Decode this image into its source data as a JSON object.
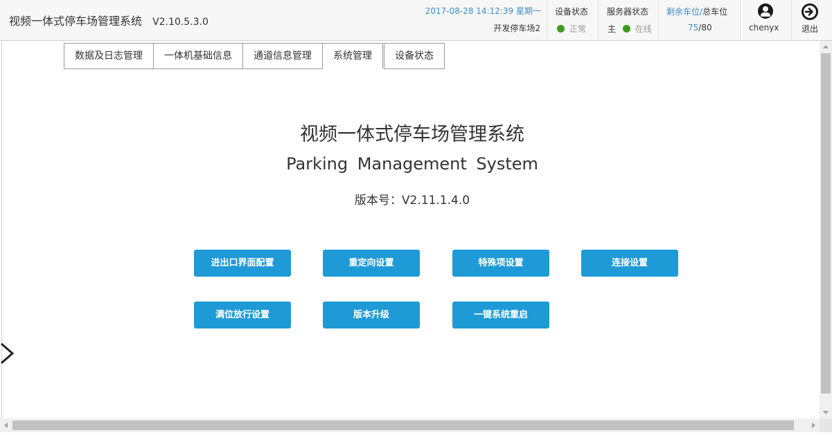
{
  "header": {
    "app_title": "视频一体式停车场管理系统",
    "app_version": "V2.10.5.3.0",
    "datetime": "2017-08-28 14:12:39 星期一",
    "parking_lot": "开发停车场2",
    "device_status_label": "设备状态",
    "device_status_value": "正常",
    "server_status_label": "服务器状态",
    "server_role": "主",
    "server_status_value": "在线",
    "spaces_label_remaining": "剩余车位",
    "spaces_label_sep": "/",
    "spaces_label_total": "总车位",
    "spaces_remaining": "75",
    "spaces_total": "80",
    "username": "chenyx",
    "exit_label": "退出"
  },
  "tabs": [
    {
      "label": "数据及日志管理"
    },
    {
      "label": "一体机基础信息"
    },
    {
      "label": "通道信息管理"
    },
    {
      "label": "系统管理"
    },
    {
      "label": "设备状态"
    }
  ],
  "main": {
    "title_cn": "视频一体式停车场管理系统",
    "title_en": "Parking Management System",
    "version_label": "版本号：V2.11.1.4.0"
  },
  "buttons": {
    "entrance_exit_ui": "进出口界面配置",
    "redirect": "重定向设置",
    "special_items": "特殊项设置",
    "connection": "连接设置",
    "full_release": "满位放行设置",
    "version_upgrade": "版本升级",
    "one_click_restart": "一键系统重启"
  },
  "colors": {
    "accent": "#1e9ad6",
    "status_ok": "#3a9b1f",
    "link_blue": "#3c8dcb"
  }
}
